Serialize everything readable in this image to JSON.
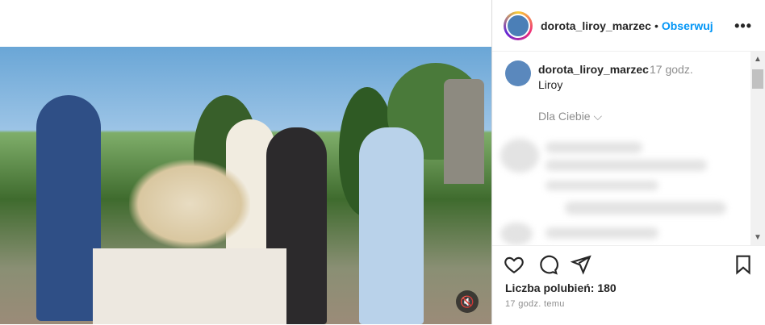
{
  "post": {
    "username": "dorota_liroy_marzec",
    "follow_label": "Obserwuj",
    "more_label": "•••"
  },
  "caption": {
    "username": "dorota_liroy_marzec",
    "time": "17 godz.",
    "text": "Liroy",
    "tag_label": "Dla Ciebie"
  },
  "footer": {
    "likes": "Liczba polubień: 180",
    "time_ago": "17 godz. temu"
  },
  "icons": {
    "like": "heart-icon",
    "comment": "comment-icon",
    "share": "share-icon",
    "save": "bookmark-icon",
    "mute": "speaker-muted-icon"
  },
  "colors": {
    "accent": "#0095f6",
    "text": "#262626",
    "muted": "#8e8e8e"
  }
}
